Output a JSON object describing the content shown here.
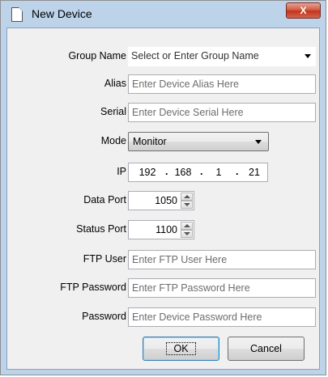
{
  "window": {
    "title": "New Device",
    "close_glyph": "X"
  },
  "fields": {
    "group_name": {
      "label": "Group Name",
      "placeholder": "Select or Enter Group Name"
    },
    "alias": {
      "label": "Alias",
      "placeholder": "Enter Device Alias Here"
    },
    "serial": {
      "label": "Serial",
      "placeholder": "Enter Device Serial Here"
    },
    "mode": {
      "label": "Mode",
      "value": "Monitor"
    },
    "ip": {
      "label": "IP",
      "octets": [
        "192",
        "168",
        "1",
        "21"
      ]
    },
    "data_port": {
      "label": "Data Port",
      "value": "1050"
    },
    "status_port": {
      "label": "Status Port",
      "value": "1100"
    },
    "ftp_user": {
      "label": "FTP User",
      "placeholder": "Enter FTP User Here"
    },
    "ftp_password": {
      "label": "FTP Password",
      "placeholder": "Enter FTP Password Here"
    },
    "password": {
      "label": "Password",
      "placeholder": "Enter Device Password Here"
    }
  },
  "buttons": {
    "ok": "OK",
    "cancel": "Cancel"
  },
  "icons": {
    "title": "document-icon",
    "close": "close-icon"
  }
}
